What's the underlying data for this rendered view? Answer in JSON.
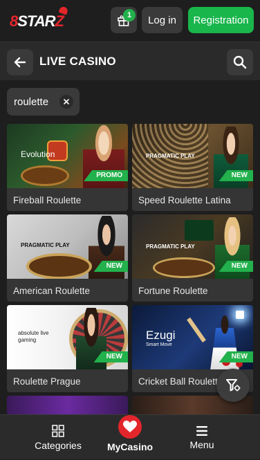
{
  "header": {
    "logo_text_left": "8STAR",
    "logo_text_right": "Z",
    "gift_badge": "1",
    "login_label": "Log in",
    "register_label": "Registration"
  },
  "section": {
    "title": "LIVE CASINO"
  },
  "filter": {
    "chip_label": "roulette"
  },
  "games": [
    {
      "name": "Fireball Roulette",
      "provider": "Evolution",
      "badge": "PROMO"
    },
    {
      "name": "Speed Roulette Latina",
      "provider": "PRAGMATIC PLAY",
      "badge": "NEW"
    },
    {
      "name": "American Roulette",
      "provider": "PRAGMATIC PLAY",
      "badge": "NEW"
    },
    {
      "name": "Fortune Roulette",
      "provider": "PRAGMATIC PLAY",
      "badge": "NEW"
    },
    {
      "name": "Roulette Prague",
      "provider": "absolute live gaming",
      "badge": "NEW"
    },
    {
      "name": "Cricket Ball Roulette",
      "provider": "Ezugi",
      "provider_sub": "Smart Move",
      "badge": "NEW"
    }
  ],
  "bottom_nav": {
    "categories": "Categories",
    "mycasino": "MyCasino",
    "menu": "Menu"
  },
  "colors": {
    "accent_green": "#19b64c",
    "accent_red": "#e3262b",
    "background": "#1e1e1e"
  }
}
